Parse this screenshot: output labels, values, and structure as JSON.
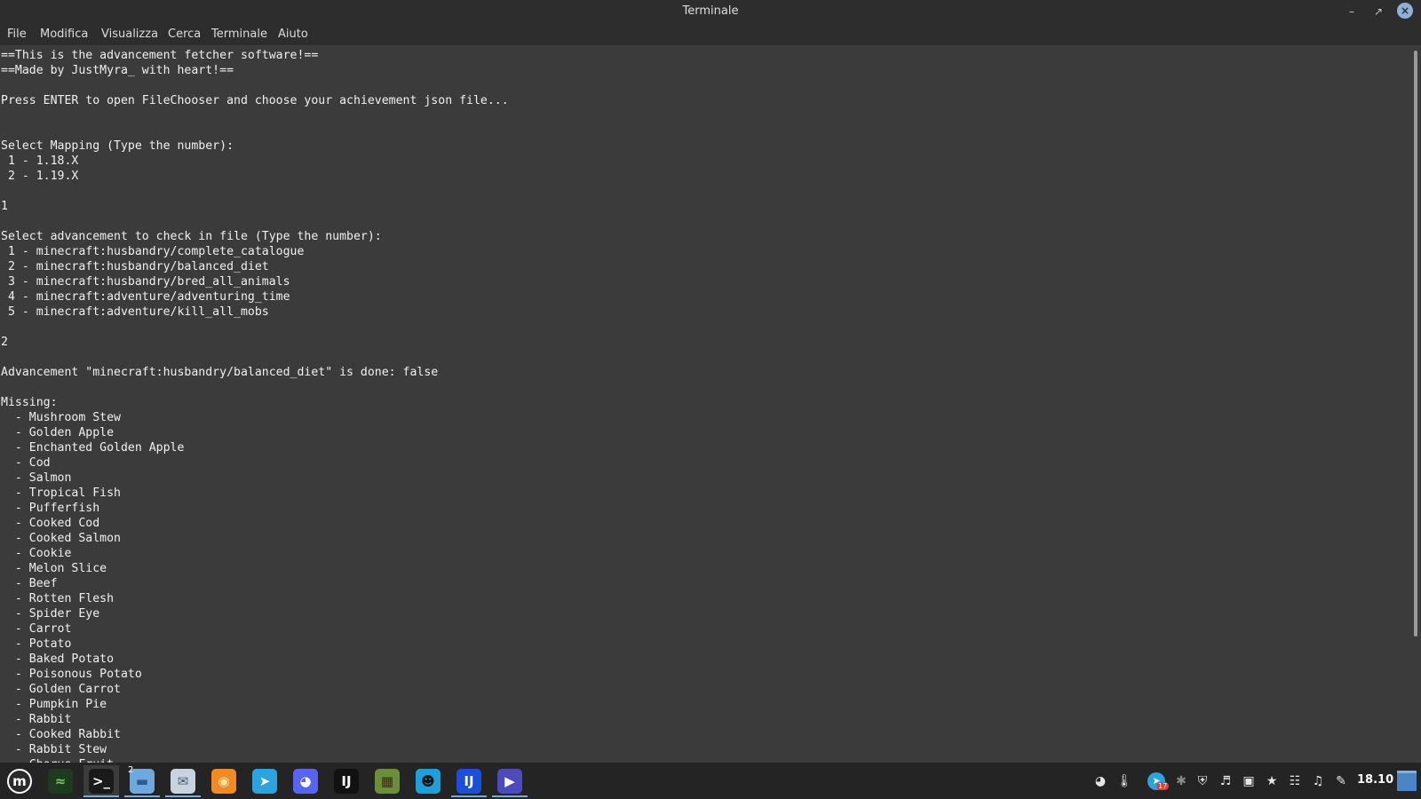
{
  "window": {
    "title": "Terminale"
  },
  "menu": [
    "File",
    "Modifica",
    "Visualizza",
    "Cerca",
    "Terminale",
    "Aiuto"
  ],
  "terminal_lines": [
    "==This is the advancement fetcher software!==",
    "==Made by JustMyra_ with heart!==",
    "",
    "Press ENTER to open FileChooser and choose your achievement json file...",
    "",
    "",
    "Select Mapping (Type the number):",
    " 1 - 1.18.X",
    " 2 - 1.19.X",
    "",
    "1",
    "",
    "Select advancement to check in file (Type the number):",
    " 1 - minecraft:husbandry/complete_catalogue",
    " 2 - minecraft:husbandry/balanced_diet",
    " 3 - minecraft:husbandry/bred_all_animals",
    " 4 - minecraft:adventure/adventuring_time",
    " 5 - minecraft:adventure/kill_all_mobs",
    "",
    "2",
    "",
    "Advancement \"minecraft:husbandry/balanced_diet\" is done: false",
    "",
    "Missing:",
    "  - Mushroom Stew",
    "  - Golden Apple",
    "  - Enchanted Golden Apple",
    "  - Cod",
    "  - Salmon",
    "  - Tropical Fish",
    "  - Pufferfish",
    "  - Cooked Cod",
    "  - Cooked Salmon",
    "  - Cookie",
    "  - Melon Slice",
    "  - Beef",
    "  - Rotten Flesh",
    "  - Spider Eye",
    "  - Carrot",
    "  - Potato",
    "  - Baked Potato",
    "  - Poisonous Potato",
    "  - Golden Carrot",
    "  - Pumpkin Pie",
    "  - Rabbit",
    "  - Cooked Rabbit",
    "  - Rabbit Stew",
    "  - Chorus Fruit"
  ],
  "taskbar": {
    "apps": [
      {
        "name": "mint-menu-icon",
        "glyph": "m",
        "color": "#2b2b2b",
        "fg": "#ffffff"
      },
      {
        "name": "system-monitor-icon",
        "glyph": "≈",
        "color": "#1f3a1f",
        "fg": "#5fd35f"
      },
      {
        "name": "terminal-icon",
        "glyph": ">_",
        "color": "#1a1a1a",
        "fg": "#ffffff"
      },
      {
        "name": "files-icon",
        "glyph": "▬",
        "color": "#6fa8dc",
        "fg": "#2d5d8a"
      },
      {
        "name": "mail-icon",
        "glyph": "✉",
        "color": "#c9d3e0",
        "fg": "#4a5d75"
      },
      {
        "name": "firefox-icon",
        "glyph": "◉",
        "color": "#f08a24",
        "fg": "#ffe6a8"
      },
      {
        "name": "telegram-icon",
        "glyph": "➤",
        "color": "#2aa3df",
        "fg": "#ffffff"
      },
      {
        "name": "discord-icon",
        "glyph": "◕",
        "color": "#5865f2",
        "fg": "#ffffff"
      },
      {
        "name": "intellij-ce-icon",
        "glyph": "IJ",
        "color": "#111111",
        "fg": "#ffffff"
      },
      {
        "name": "minecraft-icon",
        "glyph": "▦",
        "color": "#6b8e3a",
        "fg": "#3d2a14"
      },
      {
        "name": "app-shield-icon",
        "glyph": "☻",
        "color": "#1fa0d8",
        "fg": "#111111"
      },
      {
        "name": "intellij-ultimate-icon",
        "glyph": "IJ",
        "color": "#1c4fd8",
        "fg": "#ffffff"
      },
      {
        "name": "media-player-icon",
        "glyph": "▶",
        "color": "#4b4bbd",
        "fg": "#ffffff"
      }
    ],
    "files_badge": "2",
    "telegram_badge": "17",
    "clock": "18.10"
  }
}
